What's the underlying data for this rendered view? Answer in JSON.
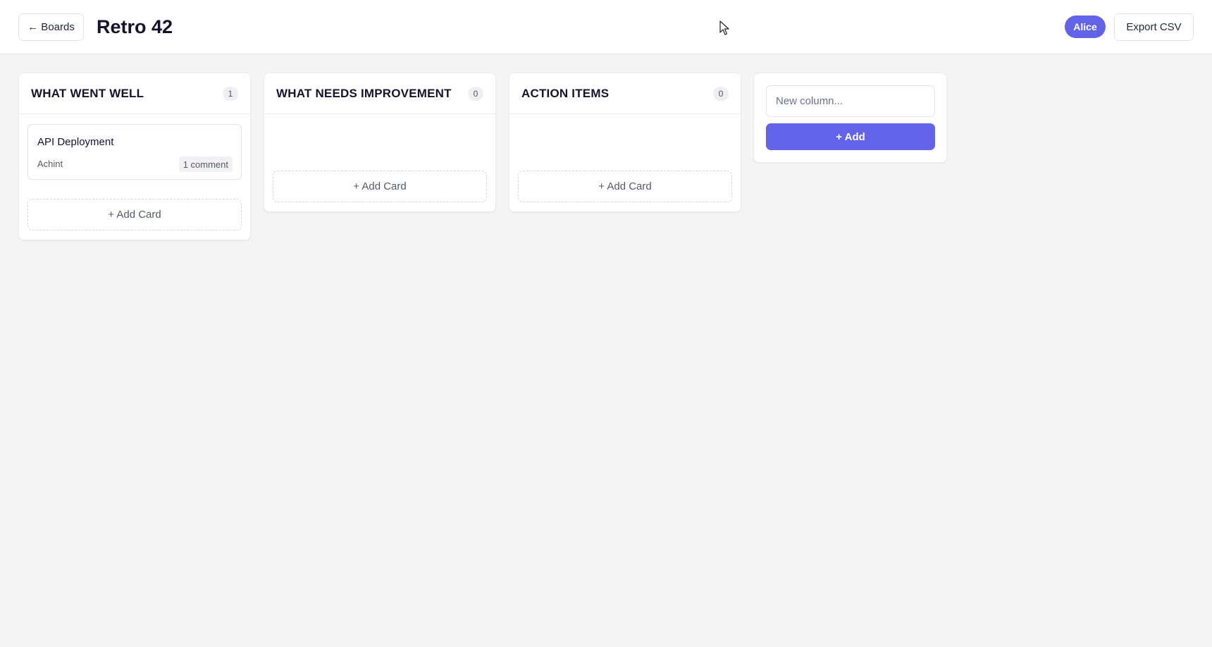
{
  "header": {
    "back_label": "← Boards",
    "title": "Retro 42",
    "user": "Alice",
    "export_label": "Export CSV"
  },
  "columns": [
    {
      "title": "WHAT WENT WELL",
      "count": "1",
      "cards": [
        {
          "title": "API Deployment",
          "author": "Achint",
          "comments": "1 comment"
        }
      ],
      "add_card_label": "+ Add Card"
    },
    {
      "title": "WHAT NEEDS IMPROVEMENT",
      "count": "0",
      "cards": [],
      "add_card_label": "+ Add Card"
    },
    {
      "title": "ACTION ITEMS",
      "count": "0",
      "cards": [],
      "add_card_label": "+ Add Card"
    }
  ],
  "new_column": {
    "placeholder": "New column...",
    "add_label": "+ Add"
  },
  "colors": {
    "accent": "#6363ea",
    "background": "#f4f4f5"
  }
}
